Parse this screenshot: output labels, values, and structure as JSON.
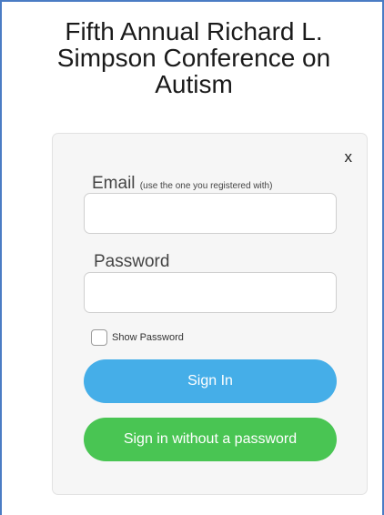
{
  "page": {
    "title": "Fifth Annual Richard L. Simpson Conference on Autism"
  },
  "login": {
    "close_label": "x",
    "email_label": "Email",
    "email_hint": "(use the one you registered with)",
    "email_value": "",
    "password_label": "Password",
    "password_value": "",
    "show_password_label": "Show Password",
    "show_password_checked": false,
    "sign_in_label": "Sign In",
    "passwordless_label": "Sign in without a password"
  },
  "colors": {
    "frame_border": "#4a7cc4",
    "card_background": "#f6f6f6",
    "sign_in_button": "#45aee8",
    "passwordless_button": "#49c553"
  }
}
